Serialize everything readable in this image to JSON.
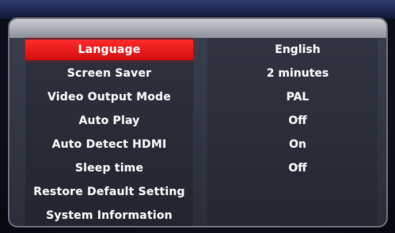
{
  "settings": {
    "items": [
      {
        "label": "Language",
        "value": "English",
        "selected": true
      },
      {
        "label": "Screen Saver",
        "value": "2 minutes",
        "selected": false
      },
      {
        "label": "Video Output Mode",
        "value": "PAL",
        "selected": false
      },
      {
        "label": "Auto Play",
        "value": "Off",
        "selected": false
      },
      {
        "label": "Auto Detect HDMI",
        "value": "On",
        "selected": false
      },
      {
        "label": "Sleep time",
        "value": "Off",
        "selected": false
      },
      {
        "label": "Restore Default Setting",
        "value": "",
        "selected": false
      },
      {
        "label": "System Information",
        "value": "",
        "selected": false
      }
    ]
  },
  "colors": {
    "selected_row": "#e01414",
    "panel": "#2f3340",
    "text": "#f2f2f2"
  }
}
